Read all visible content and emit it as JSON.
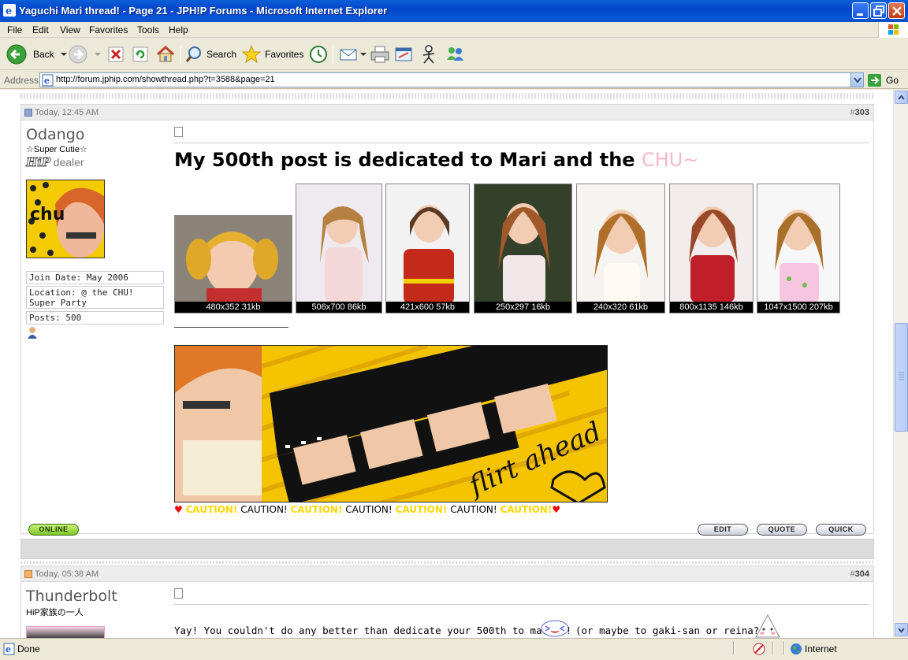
{
  "window": {
    "title": "Yaguchi Mari thread! - Page 21 - JPH!P Forums - Microsoft Internet Explorer"
  },
  "menu": [
    "File",
    "Edit",
    "View",
    "Favorites",
    "Tools",
    "Help"
  ],
  "toolbar": {
    "back_label": "Back",
    "search_label": "Search",
    "favorites_label": "Favorites"
  },
  "address": {
    "label": "Address",
    "url": "http://forum.jphip.com/showthread.php?t=3588&page=21",
    "go_label": "Go"
  },
  "posts": [
    {
      "timestamp": "Today, 12:45 AM",
      "number_prefix": "#",
      "number": "303",
      "username": "Odango",
      "user_title": "☆Super Cutie☆",
      "rank_image_text": "HiP",
      "rank_text": "dealer",
      "join_date": "Join Date: May 2006",
      "location": "Location: @ the CHU! Super Party",
      "posts_count": "Posts: 500",
      "avatar_text": "chu",
      "title_main": "My 500th post is dedicated to Mari and the ",
      "title_pink": "CHU~",
      "thumbnails": [
        "480x352 31kb",
        "506x700 86kb",
        "421x600 57kb",
        "250x297 16kb",
        "240x320 61kb",
        "800x1135 146kb",
        "1047x1500 207kb"
      ],
      "banner_text": "caution!",
      "banner_sign": "flirt ahead",
      "caution_words": [
        "CAUTION!",
        "CAUTION!",
        "CAUTION!",
        "CAUTION!",
        "CAUTION!",
        "CAUTION!",
        "CAUTION!"
      ],
      "online_label": "ONLINE",
      "edit_label": "EDIT",
      "quote_label": "QUOTE",
      "quick_label": "QUICK"
    },
    {
      "timestamp": "Today, 05:38 AM",
      "number_prefix": "#",
      "number": "304",
      "username": "Thunderbolt",
      "user_title": "HiP家族の一人",
      "message": "Yay! You couldn't do any better than dedicate your 500th to mari!!!",
      "message_tail": "(or maybe to gaki-san or reina?)"
    }
  ],
  "status": {
    "left": "Done",
    "zone": "Internet"
  },
  "colors": {
    "titlebar": "#0a56d8",
    "pink_accent": "#f5b8c8",
    "caution_yellow": "#ffd800"
  }
}
